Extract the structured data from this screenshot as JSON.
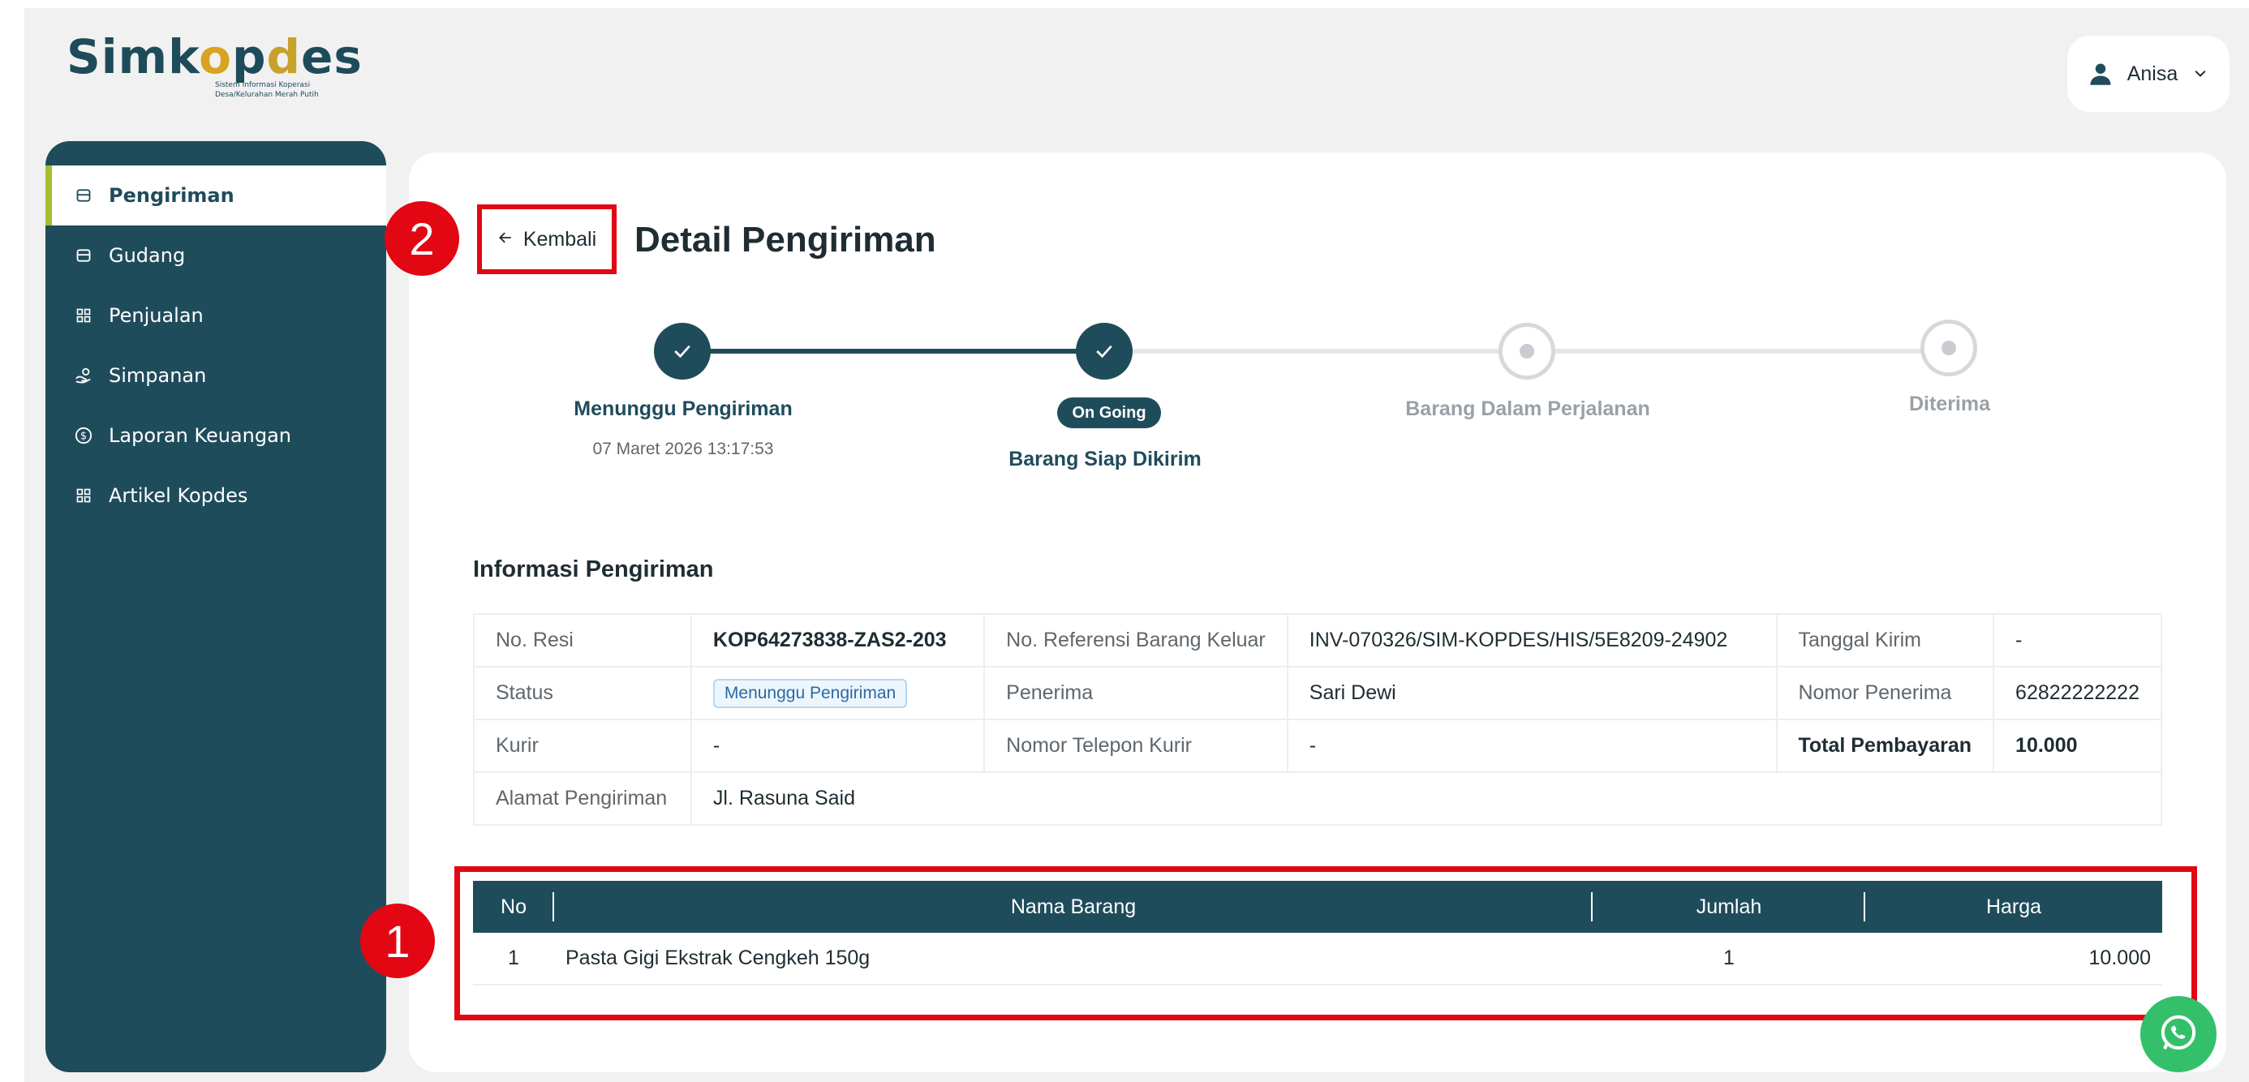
{
  "brand": {
    "name_start": "Sim",
    "name_k": "k",
    "name_o1": "o",
    "name_p": "p",
    "name_o2": "d",
    "name_end": "es",
    "tagline_1": "Sistem Informasi Koperasi",
    "tagline_2": "Desa/Kelurahan Merah Putih"
  },
  "user": {
    "name": "Anisa"
  },
  "sidebar": {
    "items": [
      {
        "label": "Pengiriman",
        "icon": "box-icon",
        "active": true
      },
      {
        "label": "Gudang",
        "icon": "box-icon",
        "active": false
      },
      {
        "label": "Penjualan",
        "icon": "grid-icon",
        "active": false
      },
      {
        "label": "Simpanan",
        "icon": "hand-coins-icon",
        "active": false
      },
      {
        "label": "Laporan Keuangan",
        "icon": "dollar-circle-icon",
        "active": false
      },
      {
        "label": "Artikel Kopdes",
        "icon": "grid-icon",
        "active": false
      }
    ]
  },
  "header": {
    "back_label": "Kembali",
    "title": "Detail Pengiriman"
  },
  "callouts": {
    "one": "1",
    "two": "2"
  },
  "stepper": {
    "steps": [
      {
        "label": "Menunggu Pengiriman",
        "date": "07 Maret 2026 13:17:53",
        "state": "done"
      },
      {
        "label": "Barang Siap Dikirim",
        "badge": "On Going",
        "state": "done"
      },
      {
        "label": "Barang Dalam Perjalanan",
        "state": "todo"
      },
      {
        "label": "Diterima",
        "state": "todo"
      }
    ]
  },
  "info": {
    "title": "Informasi Pengiriman",
    "no_resi_label": "No. Resi",
    "no_resi": "KOP64273838-ZAS2-203",
    "ref_label": "No. Referensi Barang Keluar",
    "ref": "INV-070326/SIM-KOPDES/HIS/5E8209-24902",
    "tanggal_label": "Tanggal Kirim",
    "tanggal": "-",
    "status_label": "Status",
    "status": "Menunggu Pengiriman",
    "penerima_label": "Penerima",
    "penerima": "Sari Dewi",
    "nomor_penerima_label": "Nomor Penerima",
    "nomor_penerima": "62822222222",
    "kurir_label": "Kurir",
    "kurir": "-",
    "telp_kurir_label": "Nomor Telepon Kurir",
    "telp_kurir": "-",
    "total_label": "Total Pembayaran",
    "total": "10.000",
    "alamat_label": "Alamat Pengiriman",
    "alamat": "Jl. Rasuna Said"
  },
  "items": {
    "headers": [
      "No",
      "Nama Barang",
      "Jumlah",
      "Harga"
    ],
    "rows": [
      {
        "no": "1",
        "nama": "Pasta Gigi Ekstrak Cengkeh 150g",
        "jumlah": "1",
        "harga": "10.000"
      }
    ]
  },
  "colors": {
    "primary": "#1f4c5b",
    "accent": "#a7bf2e",
    "annotation": "#e30613",
    "whatsapp": "#34c06b"
  }
}
